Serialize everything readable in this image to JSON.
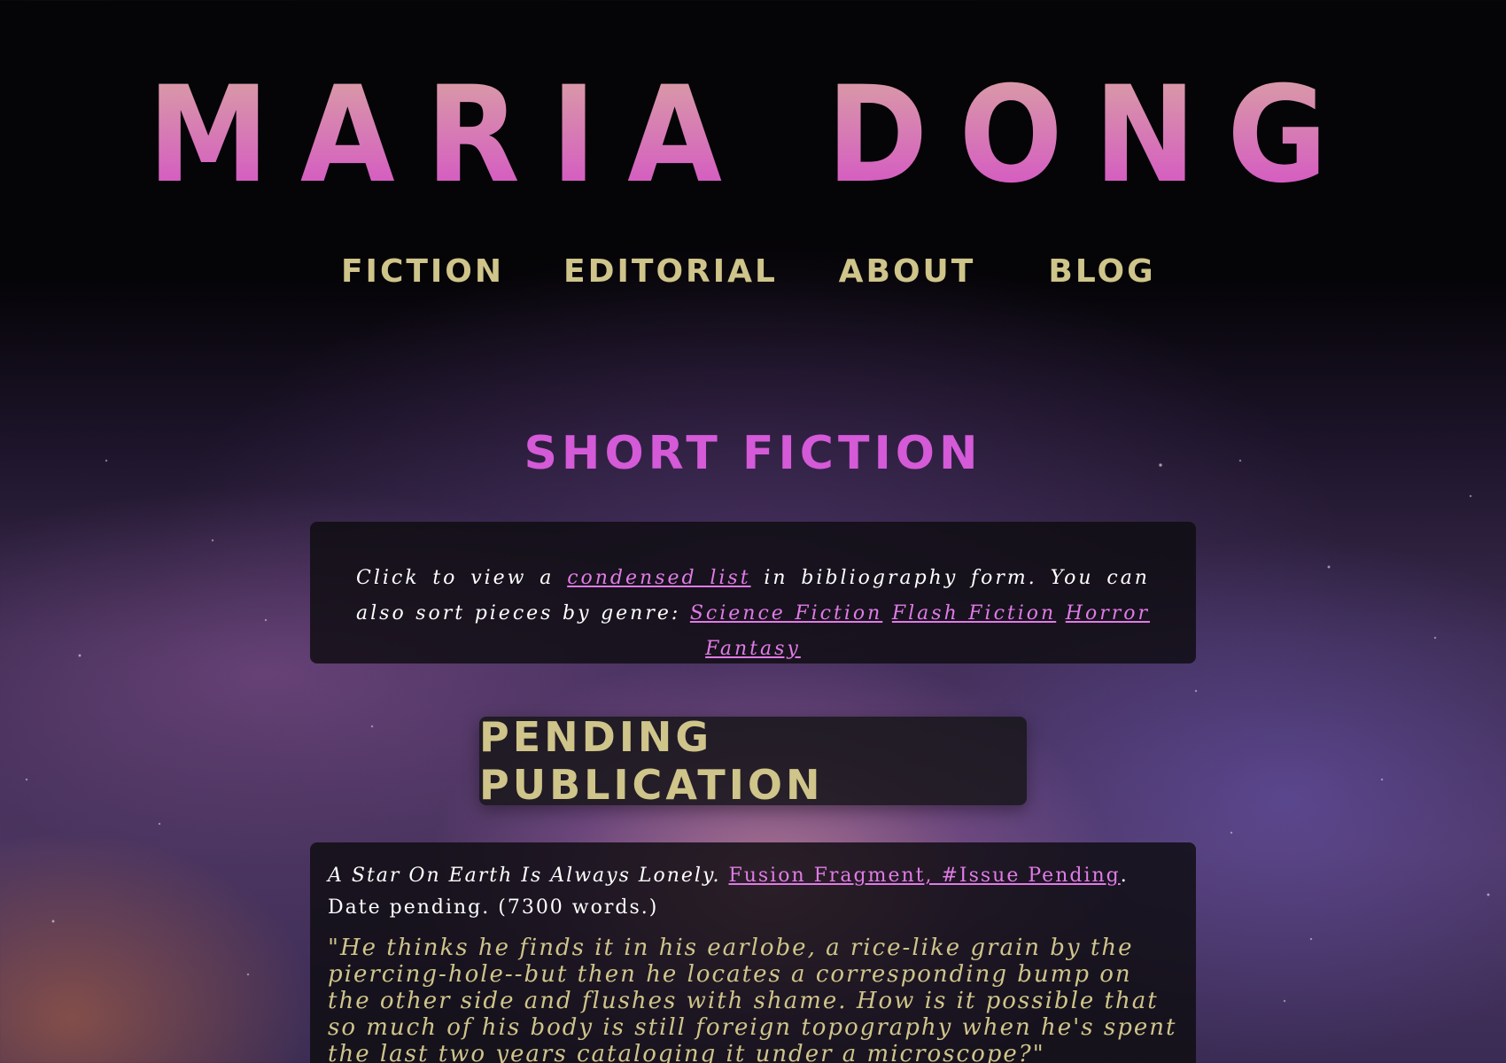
{
  "site": {
    "title": "MARIA DONG"
  },
  "nav": {
    "items": [
      {
        "label": "FICTION"
      },
      {
        "label": "EDITORIAL"
      },
      {
        "label": "ABOUT"
      },
      {
        "label": "BLOG"
      }
    ]
  },
  "main": {
    "section_title": "SHORT FICTION",
    "intro": {
      "text_before": "Click to view a ",
      "condensed_link": "condensed list",
      "text_after": " in bibliography form. You can also sort pieces by genre: ",
      "genres": [
        "Science Fiction",
        "Flash Fiction",
        "Horror",
        "Fantasy"
      ]
    },
    "pending_heading": "PENDING PUBLICATION",
    "entries": [
      {
        "title": "A Star On Earth Is Always Lonely.",
        "venue_link": "Fusion Fragment, #Issue Pending",
        "details": ". Date pending. (7300 words.)",
        "excerpt": "\"He thinks he finds it in his earlobe, a rice-like grain by the piercing-hole--but then he locates a corresponding bump on the other side and flushes with shame. How is it possible that so much of his body is still foreign topography when he's spent the last two years cataloging it under a microscope?\""
      }
    ]
  },
  "colors": {
    "title_gradient_top": "#d9a0a4",
    "title_gradient_bottom": "#d452c6",
    "nav_text": "#cfc48a",
    "section_title": "#d45ad8",
    "link": "#e07be6",
    "excerpt": "#cfc48a"
  }
}
